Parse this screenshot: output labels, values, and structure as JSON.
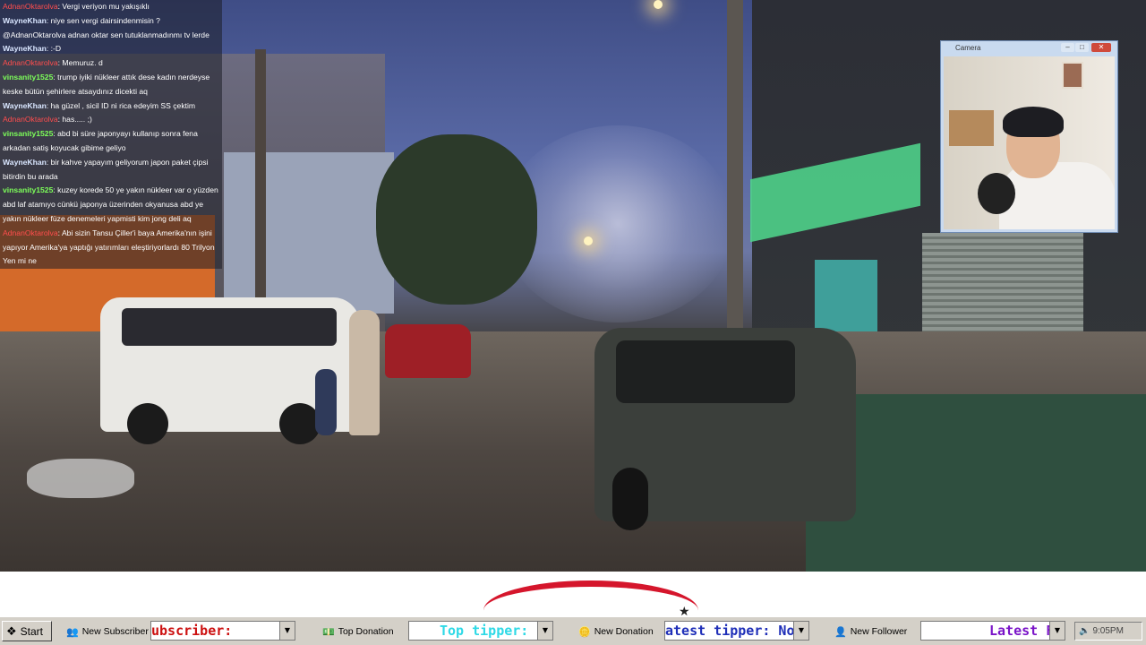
{
  "chat": {
    "messages": [
      {
        "user": "AdnanOktarolva",
        "user_color": "red",
        "text": "Vergi veriyon mu yakışıklı"
      },
      {
        "user": "WayneKhan",
        "user_color": "blue",
        "text": "niye sen vergi dairsindenmisin ?"
      },
      {
        "user": "",
        "user_color": "blue",
        "text": "@AdnanOktarolva adnan oktar sen tutuklanmadınmı tv lerde"
      },
      {
        "user": "WayneKhan",
        "user_color": "blue",
        "text": ":-D"
      },
      {
        "user": "AdnanOktarolva",
        "user_color": "red",
        "text": "Memuruz. d"
      },
      {
        "user": "vinsanity1525",
        "user_color": "green",
        "text": "trump iyiki nükleer attık dese kadın nerdeyse keske bütün şehirlere atsaydınız dicekti aq"
      },
      {
        "user": "WayneKhan",
        "user_color": "blue",
        "text": "ha güzel , sicil ID ni rica edeyim SS çektim"
      },
      {
        "user": "AdnanOktarolva",
        "user_color": "red",
        "text": "has..... ;)"
      },
      {
        "user": "vinsanity1525",
        "user_color": "green",
        "text": "abd bi süre japonyayı kullanıp sonra fena arkadan satiş koyucak gibime geliyo"
      },
      {
        "user": "WayneKhan",
        "user_color": "blue",
        "text": "bir kahve yapayım geliyorum japon paket çipsi bitirdin bu arada"
      },
      {
        "user": "vinsanity1525",
        "user_color": "green",
        "text": "kuzey korede 50 ye yakın nükleer var o yüzden abd laf atamıyo cünkü japonya üzerinden okyanusa abd ye yakın nükleer füze denemeleri yapmisti kim jong deli aq"
      },
      {
        "user": "AdnanOktarolva",
        "user_color": "red",
        "text": "Abi sizin Tansu Çiller'i baya Amerika'nın işini yapıyor Amerika'ya yaptığı yatırımları eleştiriyorlardı 80 Trilyon Yen mi ne"
      }
    ]
  },
  "camera": {
    "title": "Camera",
    "minimize_glyph": "–",
    "maximize_glyph": "□",
    "close_glyph": "✕"
  },
  "taskbar": {
    "start_label": "Start",
    "items": [
      {
        "label": "New Subscriber",
        "icon": "people-icon"
      },
      {
        "label": "Top Donation",
        "icon": "money-icon"
      },
      {
        "label": "New Donation",
        "icon": "coins-icon"
      },
      {
        "label": "New Follower",
        "icon": "person-icon"
      }
    ],
    "tickers": [
      {
        "text": "ubscriber:",
        "color": "#cc1010"
      },
      {
        "text": "Top tipper: N",
        "color": "#2ed9e6"
      },
      {
        "text": "atest tipper: No",
        "color": "#1f2fb8"
      },
      {
        "text": "Latest F",
        "color": "#7a14c8"
      }
    ],
    "clock": "9:05PM"
  },
  "colors": {
    "chat_red": "#ff4d4d",
    "chat_green": "#7dff5a",
    "logo_red": "#d5162c"
  }
}
